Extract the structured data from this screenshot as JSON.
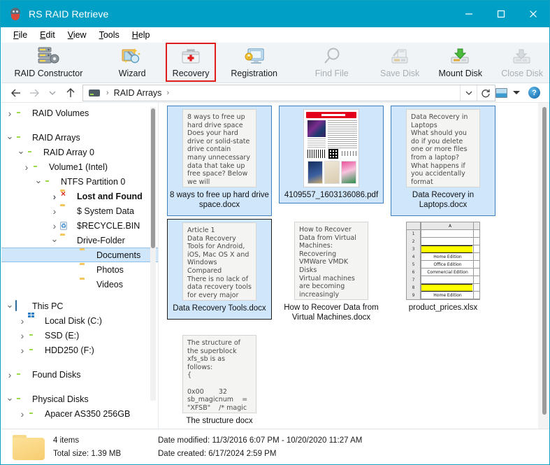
{
  "window": {
    "title": "RS RAID Retrieve",
    "icon": "app-icon",
    "minimize": "–",
    "maximize": "□",
    "close": "✕",
    "titlebar_color": "#00a0c6"
  },
  "menubar": {
    "items": [
      {
        "label": "File",
        "accel": "F"
      },
      {
        "label": "Edit",
        "accel": "E"
      },
      {
        "label": "View",
        "accel": "V"
      },
      {
        "label": "Tools",
        "accel": "T"
      },
      {
        "label": "Help",
        "accel": "H"
      }
    ]
  },
  "toolbar": {
    "selection_outline_color": "#e01b1b",
    "buttons": [
      {
        "label": "RAID Constructor",
        "icon": "raid-constructor-icon",
        "enabled": true,
        "selected": false
      },
      {
        "label": "Wizard",
        "icon": "wizard-icon",
        "enabled": true,
        "selected": false
      },
      {
        "label": "Recovery",
        "icon": "recovery-kit-icon",
        "enabled": true,
        "selected": true
      },
      {
        "label": "Registration",
        "icon": "registration-key-icon",
        "enabled": true,
        "selected": false
      },
      {
        "label": "Find File",
        "icon": "magnifier-icon",
        "enabled": false,
        "selected": false
      },
      {
        "label": "Save Disk",
        "icon": "save-disk-icon",
        "enabled": false,
        "selected": false
      },
      {
        "label": "Mount Disk",
        "icon": "mount-disk-icon",
        "enabled": true,
        "selected": false
      },
      {
        "label": "Close Disk",
        "icon": "close-disk-icon",
        "enabled": false,
        "selected": false
      }
    ]
  },
  "navbar": {
    "back": "back-arrow-icon",
    "forward": "forward-arrow-icon",
    "history": "chevron-down-icon",
    "up": "up-arrow-icon",
    "breadcrumbs": [
      "RAID Arrays"
    ],
    "breadcrumb_separator": "›",
    "dropdown": "chevron-down-icon",
    "refresh": "refresh-icon",
    "view_mode": "thumbnails-icon",
    "view_dropdown": "chevron-down-icon",
    "help": "?"
  },
  "tree": {
    "items": [
      {
        "label": "RAID Volumes",
        "indent": 0,
        "state": "collapsed",
        "icon": "drive-icon",
        "bold": false,
        "selected": false
      },
      {
        "label": "RAID Arrays",
        "indent": 0,
        "state": "expanded",
        "icon": "drive-icon",
        "bold": false,
        "selected": false
      },
      {
        "label": "RAID Array 0",
        "indent": 1,
        "state": "expanded",
        "icon": "drive-icon",
        "bold": false,
        "selected": false
      },
      {
        "label": "Volume1 (Intel)",
        "indent": 2,
        "state": "collapsed",
        "icon": "drive-icon",
        "bold": false,
        "selected": false
      },
      {
        "label": "NTFS Partition 0",
        "indent": 3,
        "state": "expanded",
        "icon": "drive-icon",
        "bold": false,
        "selected": false
      },
      {
        "label": "Lost and Found",
        "indent": 4,
        "state": "collapsed",
        "icon": "folder-lost-icon",
        "bold": true,
        "selected": false
      },
      {
        "label": "$ System Data",
        "indent": 4,
        "state": "collapsed",
        "icon": "folder-icon",
        "bold": false,
        "selected": false
      },
      {
        "label": "$RECYCLE.BIN",
        "indent": 4,
        "state": "collapsed",
        "icon": "recycle-bin-icon",
        "bold": false,
        "selected": false
      },
      {
        "label": "Drive-Folder",
        "indent": 4,
        "state": "expanded",
        "icon": "folder-icon",
        "bold": false,
        "selected": false
      },
      {
        "label": "Documents",
        "indent": 5,
        "state": "leaf",
        "icon": "folder-icon",
        "bold": false,
        "selected": true
      },
      {
        "label": "Photos",
        "indent": 5,
        "state": "leaf",
        "icon": "folder-icon",
        "bold": false,
        "selected": false
      },
      {
        "label": "Videos",
        "indent": 5,
        "state": "leaf",
        "icon": "folder-icon",
        "bold": false,
        "selected": false
      },
      {
        "label": "This PC",
        "indent": 0,
        "state": "expanded",
        "icon": "computer-icon",
        "bold": false,
        "selected": false
      },
      {
        "label": "Local Disk (C:)",
        "indent": 1,
        "state": "collapsed",
        "icon": "windows-disk-icon",
        "bold": false,
        "selected": false
      },
      {
        "label": "SSD (E:)",
        "indent": 1,
        "state": "collapsed",
        "icon": "drive-icon",
        "bold": false,
        "selected": false
      },
      {
        "label": "HDD250 (F:)",
        "indent": 1,
        "state": "collapsed",
        "icon": "drive-icon",
        "bold": false,
        "selected": false
      },
      {
        "label": "Found Disks",
        "indent": 0,
        "state": "collapsed",
        "icon": "drive-icon",
        "bold": false,
        "selected": false
      },
      {
        "label": "Physical Disks",
        "indent": 0,
        "state": "expanded",
        "icon": "drive-icon",
        "bold": false,
        "selected": false
      },
      {
        "label": "Apacer AS350 256GB",
        "indent": 1,
        "state": "collapsed",
        "icon": "drive-icon",
        "bold": false,
        "selected": false
      }
    ]
  },
  "files": {
    "tiles": [
      {
        "name": "8 ways to free up hard drive space.docx",
        "preview_type": "text",
        "preview_text": "8 ways to free up hard drive space\nDoes your hard drive or solid-state drive contain many unnecessary data that take up free space? Below we will",
        "selected": true,
        "focused": false
      },
      {
        "name": "4109557_1603136086.pdf",
        "preview_type": "pdf",
        "preview_text": "",
        "selected": true,
        "focused": false
      },
      {
        "name": "Data Recovery in Laptops.docx",
        "preview_type": "text",
        "preview_text": "Data Recovery in Laptops\nWhat should you do if you delete one or more files from a laptop? What happens if you accidentally format",
        "selected": true,
        "focused": false
      },
      {
        "name": "Data Recovery Tools.docx",
        "preview_type": "text",
        "preview_text": "Article 1\nData Recovery Tools for Android, iOS, Mac OS X and Windows Compared\nThere is no lack of data recovery tools for every major",
        "selected": true,
        "focused": true
      },
      {
        "name": "How to Recover Data from Virtual Machines.docx",
        "preview_type": "text",
        "preview_text": "How to Recover Data from Virtual Machines: Recovering VMWare VMDK Disks\nVirtual machines are becoming increasingly popular",
        "selected": false,
        "focused": false
      },
      {
        "name": "product_prices.xlsx",
        "preview_type": "spreadsheet",
        "preview_text": "",
        "selected": false,
        "focused": false
      },
      {
        "name": "The structure docx",
        "preview_type": "text",
        "preview_text": "The structure of the superblock xfs_sb is as follows:\n{\n\n0x00       32    sb_magicnum    = \"XFSB\"    /* magic",
        "selected": false,
        "focused": false
      }
    ],
    "spreadsheet_preview": {
      "column_header": "A",
      "rows": [
        {
          "num": "1",
          "value": "",
          "highlight": false
        },
        {
          "num": "2",
          "value": "",
          "highlight": false
        },
        {
          "num": "3",
          "value": "",
          "highlight": true
        },
        {
          "num": "4",
          "value": "Home Edition",
          "highlight": false
        },
        {
          "num": "5",
          "value": "Office Edition",
          "highlight": false
        },
        {
          "num": "6",
          "value": "Commercial Edition",
          "highlight": false
        },
        {
          "num": "7",
          "value": "",
          "highlight": false
        },
        {
          "num": "8",
          "value": "",
          "highlight": true
        },
        {
          "num": "9",
          "value": "Home Edition",
          "highlight": false
        }
      ]
    }
  },
  "status": {
    "folder_icon": "folder-icon",
    "items_count": "4 items",
    "total_size": "Total size: 1.39 MB",
    "date_modified": "Date modified:  11/3/2016 6:07 PM - 10/20/2020 11:27 AM",
    "date_created": "Date created:  6/17/2024 2:59 PM"
  }
}
